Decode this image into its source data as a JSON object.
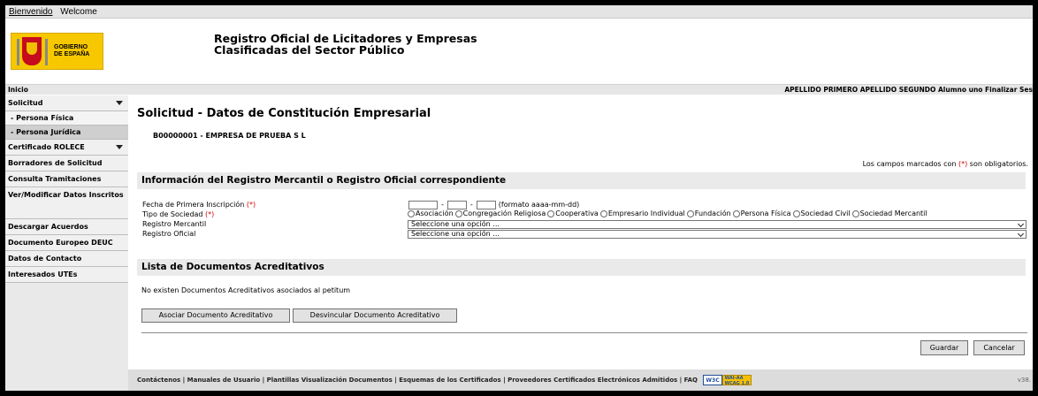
{
  "lang_bar": {
    "link_es": "Bienvenido",
    "link_en": "Welcome"
  },
  "logo": {
    "line1": "GOBIERNO",
    "line2": "DE ESPAÑA"
  },
  "site_title": {
    "line1": "Registro Oficial de Licitadores y Empresas",
    "line2": "Clasificadas del Sector Público"
  },
  "top_strip": {
    "home": "Inicio",
    "user": "APELLIDO PRIMERO APELLIDO SEGUNDO Alumno uno Finalizar Ses"
  },
  "sidebar": {
    "items": [
      {
        "label": "Solicitud",
        "type": "group"
      },
      {
        "label": "- Persona Física",
        "type": "sub"
      },
      {
        "label": "- Persona Jurídica",
        "type": "sub"
      },
      {
        "label": "Certificado ROLECE",
        "type": "group"
      },
      {
        "label": "Borradores de Solicitud",
        "type": "item"
      },
      {
        "label": "Consulta Tramitaciones",
        "type": "item"
      },
      {
        "label": "Ver/Modificar Datos Inscritos",
        "type": "item"
      },
      {
        "label": "Descargar Acuerdos",
        "type": "item"
      },
      {
        "label": "Documento Europeo DEUC",
        "type": "item"
      },
      {
        "label": "Datos de Contacto",
        "type": "item"
      },
      {
        "label": "Interesados UTEs",
        "type": "item"
      }
    ]
  },
  "main": {
    "title": "Solicitud - Datos de Constitución Empresarial",
    "company": "B00000001 - EMPRESA DE PRUEBA S L",
    "mandatory_note_pre": "Los campos marcados con ",
    "mandatory_mark": "(*)",
    "mandatory_note_post": " son obligatorios.",
    "section1_title": "Información del Registro Mercantil o Registro Oficial correspondiente",
    "fields": {
      "fecha_label": "Fecha de Primera Inscripción",
      "fecha_required": "(*)",
      "fecha_sep": "-",
      "fecha_format": "(formato aaaa-mm-dd)",
      "tipo_label": "Tipo de Sociedad",
      "tipo_required": "(*)",
      "tipo_options": [
        "Asociación",
        "Congregación Religiosa",
        "Cooperativa",
        "Empresario Individual",
        "Fundación",
        "Persona Física",
        "Sociedad Civil",
        "Sociedad Mercantil"
      ],
      "mercantil_label": "Registro Mercantil",
      "mercantil_value": "Seleccione una opción ...",
      "oficial_label": "Registro Oficial",
      "oficial_value": "Seleccione una opción ..."
    },
    "section2_title": "Lista de Documentos Acreditativos",
    "no_docs": "No existen Documentos Acreditativos asociados al petitum",
    "btn_asociar": "Asociar Documento Acreditativo",
    "btn_desvincular": "Desvincular Documento Acreditativo",
    "btn_guardar": "Guardar",
    "btn_cancelar": "Cancelar"
  },
  "footer": {
    "links": "Contáctenos | Manuales de Usuario | Plantillas Visualización Documentos | Esquemas de los Certificados  |  Proveedores Certificados Electrónicos Admitidos | FAQ",
    "w3c": "W3C",
    "wai_line1": "WAI-AA",
    "wai_line2": "WCAG 1.0",
    "version": "v38."
  }
}
